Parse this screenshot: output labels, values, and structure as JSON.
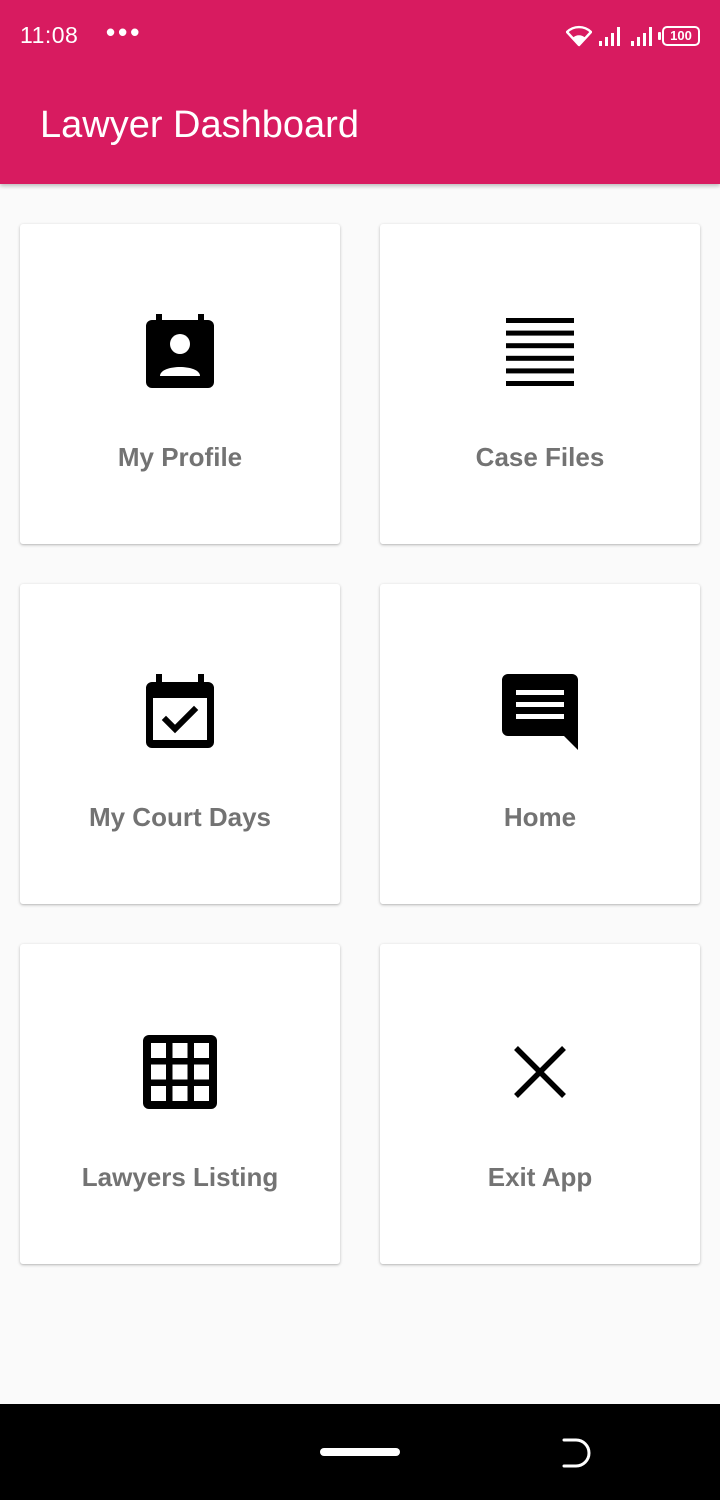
{
  "status_bar": {
    "time": "11:08",
    "dots": "•••",
    "battery": "100"
  },
  "app_bar": {
    "title": "Lawyer Dashboard",
    "color": "#d81b60"
  },
  "dashboard": {
    "cards": [
      {
        "label": "My Profile",
        "icon": "contact-calendar-icon"
      },
      {
        "label": "Case Files",
        "icon": "list-lines-icon"
      },
      {
        "label": "My Court Days",
        "icon": "event-available-icon"
      },
      {
        "label": "Home",
        "icon": "chat-message-icon"
      },
      {
        "label": "Lawyers Listing",
        "icon": "grid-icon"
      },
      {
        "label": "Exit App",
        "icon": "close-icon"
      }
    ]
  }
}
